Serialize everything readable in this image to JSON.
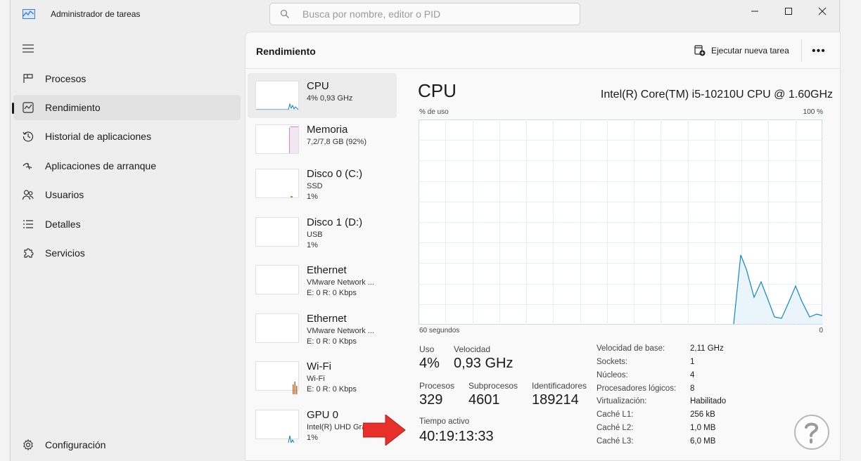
{
  "window": {
    "title": "Administrador de tareas"
  },
  "search": {
    "placeholder": "Busca por nombre, editor o PID"
  },
  "sidebar": {
    "items": [
      {
        "label": "Procesos",
        "icon": "grid-icon"
      },
      {
        "label": "Rendimiento",
        "icon": "performance-icon"
      },
      {
        "label": "Historial de aplicaciones",
        "icon": "history-icon"
      },
      {
        "label": "Aplicaciones de arranque",
        "icon": "startup-icon"
      },
      {
        "label": "Usuarios",
        "icon": "users-icon"
      },
      {
        "label": "Detalles",
        "icon": "list-icon"
      },
      {
        "label": "Servicios",
        "icon": "puzzle-icon"
      }
    ],
    "settings": "Configuración",
    "active": "Rendimiento"
  },
  "header": {
    "title": "Rendimiento",
    "run_task": "Ejecutar nueva tarea"
  },
  "devices": [
    {
      "name": "CPU",
      "line2": "4% 0,93 GHz",
      "line3": "",
      "color": "#0a7fc2"
    },
    {
      "name": "Memoria",
      "line2": "7,2/7,8 GB (92%)",
      "line3": "",
      "color": "#8b1a8b"
    },
    {
      "name": "Disco 0 (C:)",
      "line2": "SSD",
      "line3": "1%",
      "color": "#4f8a10"
    },
    {
      "name": "Disco 1 (D:)",
      "line2": "USB",
      "line3": "1%",
      "color": "#4f8a10"
    },
    {
      "name": "Ethernet",
      "line2": "VMware Network ...",
      "line3": "E: 0 R: 0 Kbps",
      "color": "#a0522d"
    },
    {
      "name": "Ethernet",
      "line2": "VMware Network ...",
      "line3": "E: 0 R: 0 Kbps",
      "color": "#a0522d"
    },
    {
      "name": "Wi-Fi",
      "line2": "Wi-Fi",
      "line3": "E: 0 R: 0 Kbps",
      "color": "#c0662a"
    },
    {
      "name": "GPU 0",
      "line2": "Intel(R) UHD Grap...",
      "line3": "1%",
      "color": "#0a7fc2"
    }
  ],
  "cpu": {
    "title": "CPU",
    "model": "Intel(R) Core(TM) i5-10210U CPU @ 1.60GHz",
    "graph": {
      "ylabel": "% de uso",
      "ymax": "100 %",
      "xlabel": "60 segundos",
      "xmin": "0",
      "line_color": "#1185c8",
      "fill_color": "#eaf4fb"
    },
    "stats": {
      "uso_label": "Uso",
      "uso": "4%",
      "velocidad_label": "Velocidad",
      "velocidad": "0,93 GHz",
      "procesos_label": "Procesos",
      "procesos": "329",
      "subprocesos_label": "Subprocesos",
      "subprocesos": "4601",
      "identificadores_label": "Identificadores",
      "identificadores": "189214",
      "tiempo_label": "Tiempo activo",
      "tiempo": "40:19:13:33"
    },
    "details": [
      {
        "k": "Velocidad de base:",
        "v": "2,11 GHz"
      },
      {
        "k": "Sockets:",
        "v": "1"
      },
      {
        "k": "Núcleos:",
        "v": "4"
      },
      {
        "k": "Procesadores lógicos:",
        "v": "8"
      },
      {
        "k": "Virtualización:",
        "v": "Habilitado"
      },
      {
        "k": "Caché L1:",
        "v": "256 kB"
      },
      {
        "k": "Caché L2:",
        "v": "1,0 MB"
      },
      {
        "k": "Caché L3:",
        "v": "6,0 MB"
      }
    ]
  }
}
